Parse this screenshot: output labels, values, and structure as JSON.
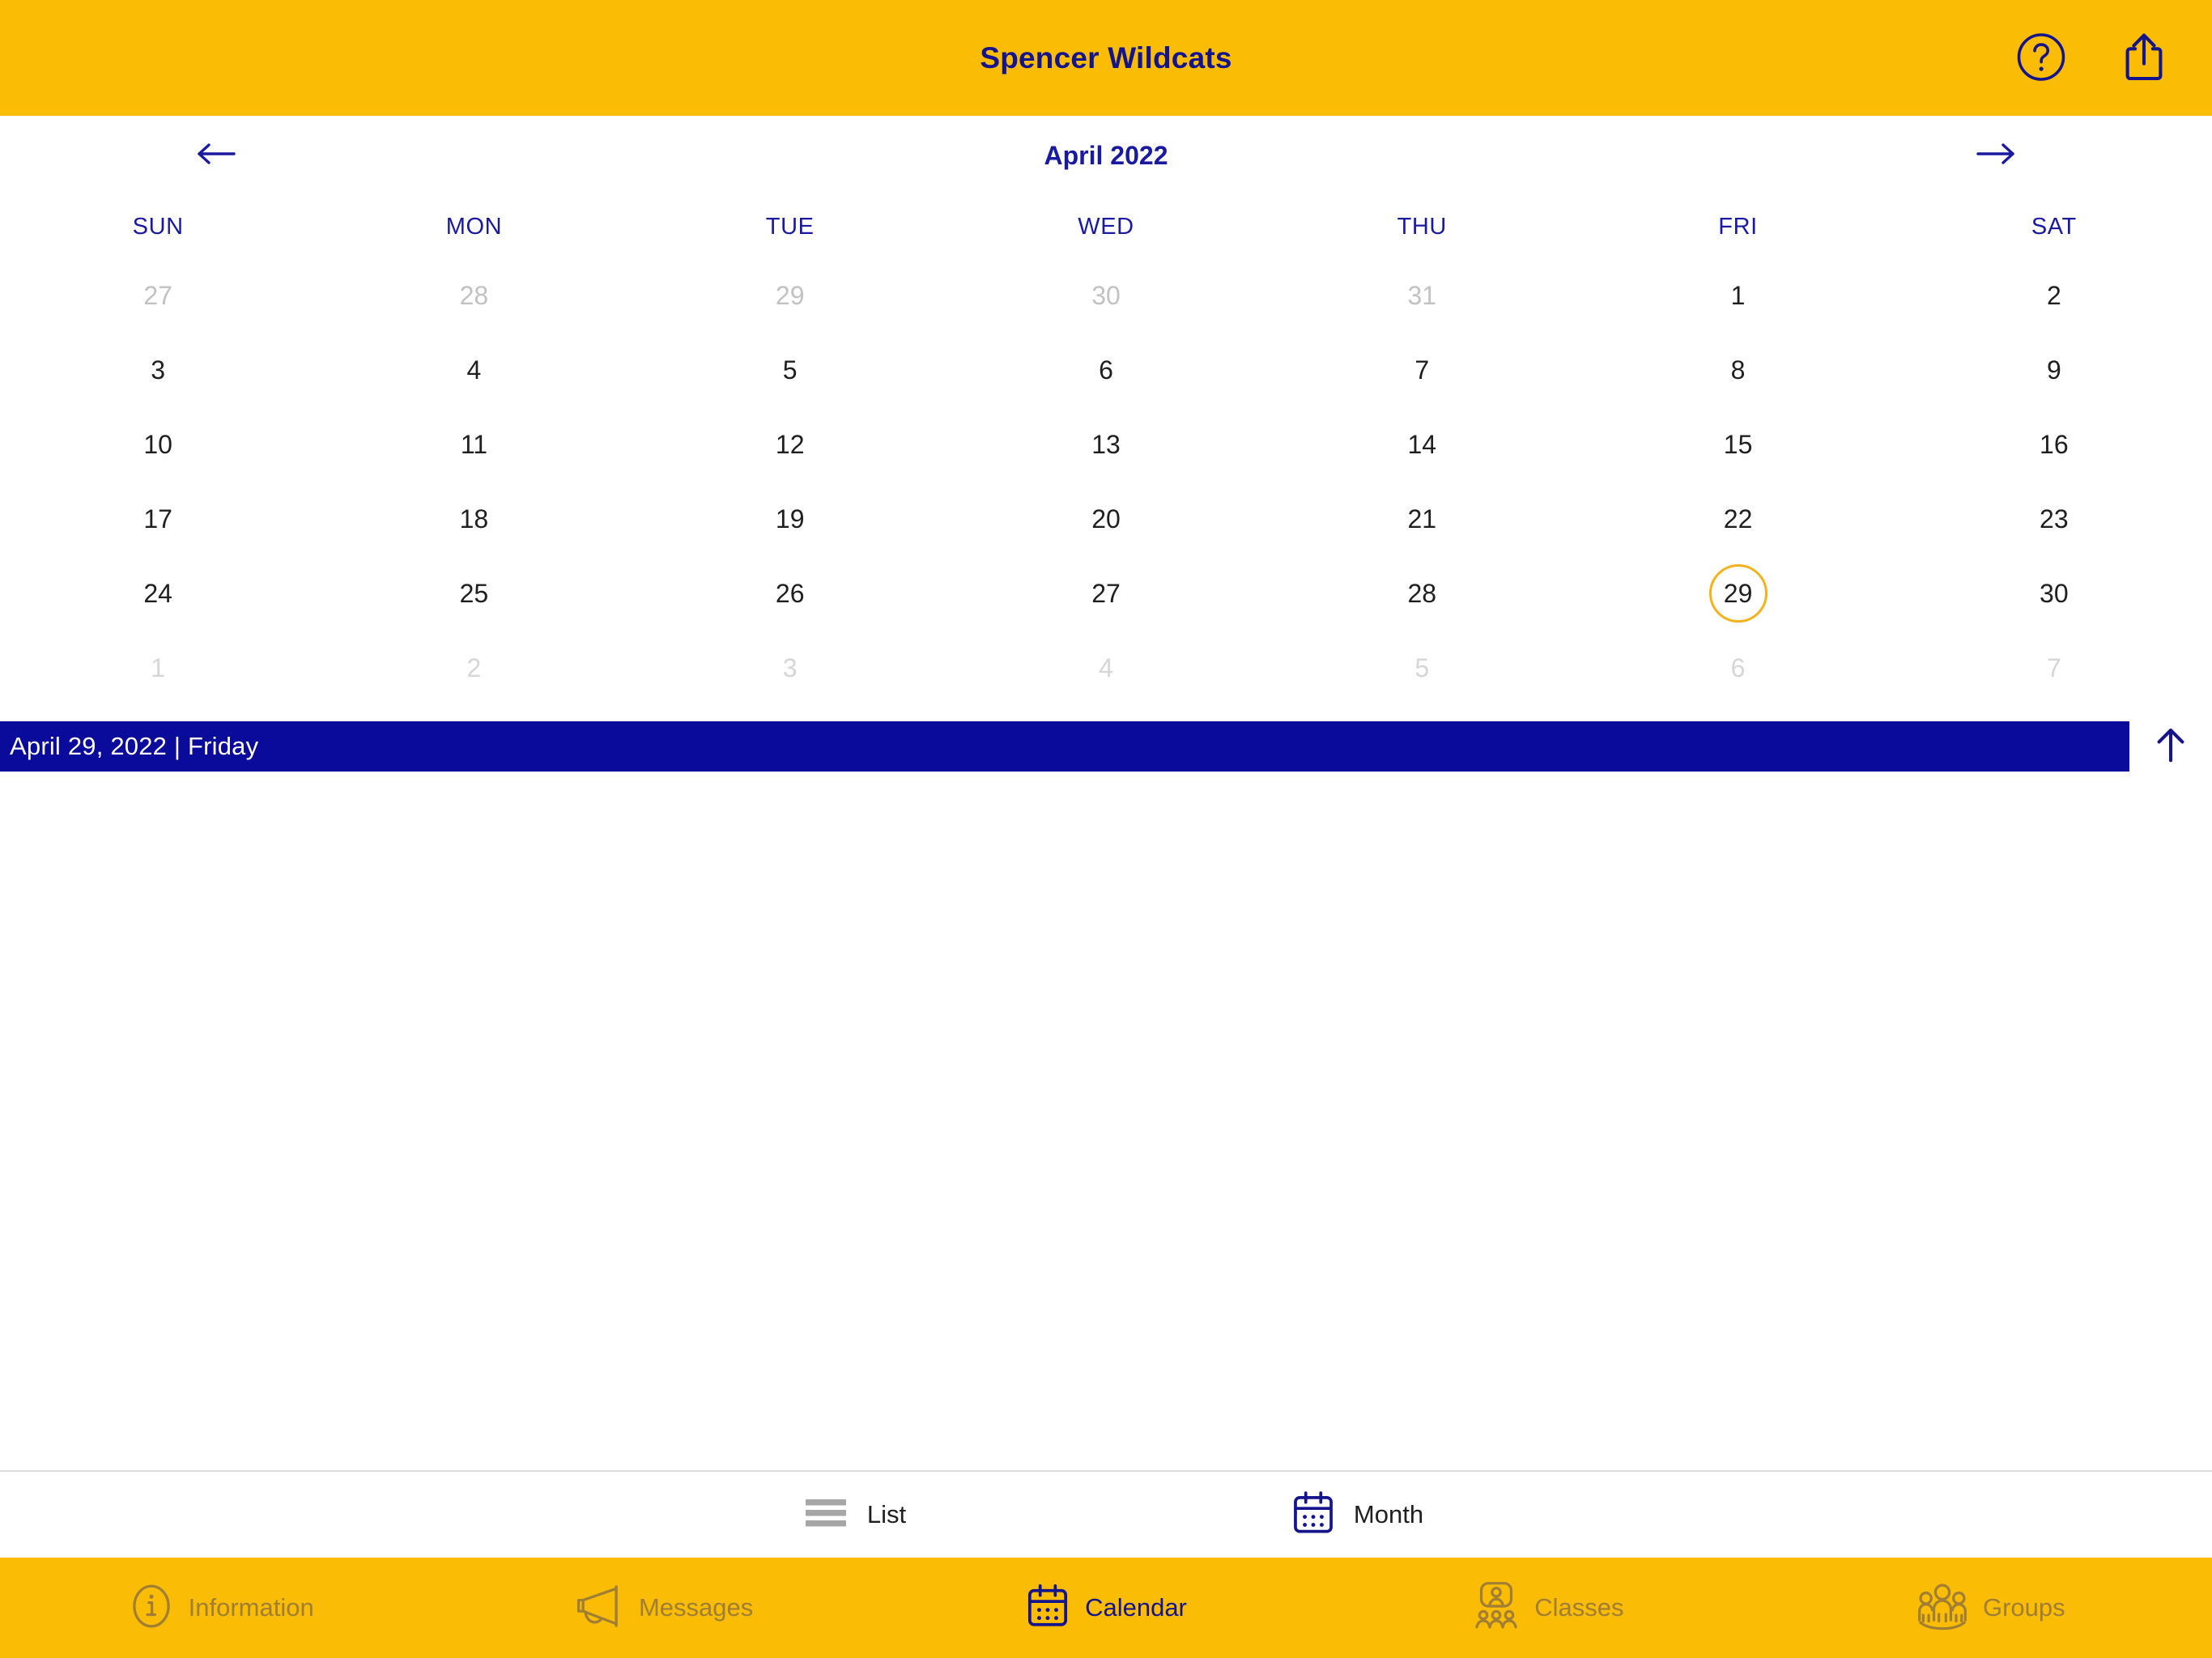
{
  "header": {
    "title": "Spencer Wildcats",
    "bg_color": "#FBBC05",
    "text_color": "#14148C",
    "help_icon": "question-mark-circle-icon",
    "share_icon": "share-upload-icon"
  },
  "calendar": {
    "month_label": "April 2022",
    "prev_icon": "arrow-left-icon",
    "next_icon": "arrow-right-icon",
    "weekdays": [
      "SUN",
      "MON",
      "TUE",
      "WED",
      "THU",
      "FRI",
      "SAT"
    ],
    "accent_color": "#1A1AA0",
    "selected_ring_color": "#F5B21C",
    "weeks": [
      [
        {
          "n": "27",
          "state": "muted"
        },
        {
          "n": "28",
          "state": "muted"
        },
        {
          "n": "29",
          "state": "muted"
        },
        {
          "n": "30",
          "state": "muted"
        },
        {
          "n": "31",
          "state": "muted"
        },
        {
          "n": "1",
          "state": "current"
        },
        {
          "n": "2",
          "state": "current"
        }
      ],
      [
        {
          "n": "3",
          "state": "current"
        },
        {
          "n": "4",
          "state": "current"
        },
        {
          "n": "5",
          "state": "current"
        },
        {
          "n": "6",
          "state": "current"
        },
        {
          "n": "7",
          "state": "current"
        },
        {
          "n": "8",
          "state": "current"
        },
        {
          "n": "9",
          "state": "current"
        }
      ],
      [
        {
          "n": "10",
          "state": "current"
        },
        {
          "n": "11",
          "state": "current"
        },
        {
          "n": "12",
          "state": "current"
        },
        {
          "n": "13",
          "state": "current"
        },
        {
          "n": "14",
          "state": "current"
        },
        {
          "n": "15",
          "state": "current"
        },
        {
          "n": "16",
          "state": "current"
        }
      ],
      [
        {
          "n": "17",
          "state": "current"
        },
        {
          "n": "18",
          "state": "current"
        },
        {
          "n": "19",
          "state": "current"
        },
        {
          "n": "20",
          "state": "current"
        },
        {
          "n": "21",
          "state": "current"
        },
        {
          "n": "22",
          "state": "current"
        },
        {
          "n": "23",
          "state": "current"
        }
      ],
      [
        {
          "n": "24",
          "state": "current"
        },
        {
          "n": "25",
          "state": "current"
        },
        {
          "n": "26",
          "state": "current"
        },
        {
          "n": "27",
          "state": "current"
        },
        {
          "n": "28",
          "state": "current"
        },
        {
          "n": "29",
          "state": "selected"
        },
        {
          "n": "30",
          "state": "current"
        }
      ],
      [
        {
          "n": "1",
          "state": "faint"
        },
        {
          "n": "2",
          "state": "faint"
        },
        {
          "n": "3",
          "state": "faint"
        },
        {
          "n": "4",
          "state": "faint"
        },
        {
          "n": "5",
          "state": "faint"
        },
        {
          "n": "6",
          "state": "faint"
        },
        {
          "n": "7",
          "state": "faint"
        }
      ]
    ]
  },
  "day_bar": {
    "text": "April 29, 2022 | Friday",
    "bg_color": "#0A0A9B",
    "text_color": "#FFFFFF",
    "collapse_icon": "arrow-up-icon"
  },
  "view_switch": {
    "options": [
      {
        "label": "List",
        "icon": "list-lines-icon",
        "active": false
      },
      {
        "label": "Month",
        "icon": "calendar-month-icon",
        "active": true
      }
    ]
  },
  "tabbar": {
    "bg_color": "#FBBC05",
    "inactive_color": "#A07E33",
    "active_color": "#14148C",
    "tabs": [
      {
        "label": "Information",
        "icon": "info-circle-icon",
        "active": false
      },
      {
        "label": "Messages",
        "icon": "megaphone-icon",
        "active": false
      },
      {
        "label": "Calendar",
        "icon": "calendar-icon",
        "active": true
      },
      {
        "label": "Classes",
        "icon": "classes-icon",
        "active": false
      },
      {
        "label": "Groups",
        "icon": "groups-people-icon",
        "active": false
      }
    ]
  }
}
